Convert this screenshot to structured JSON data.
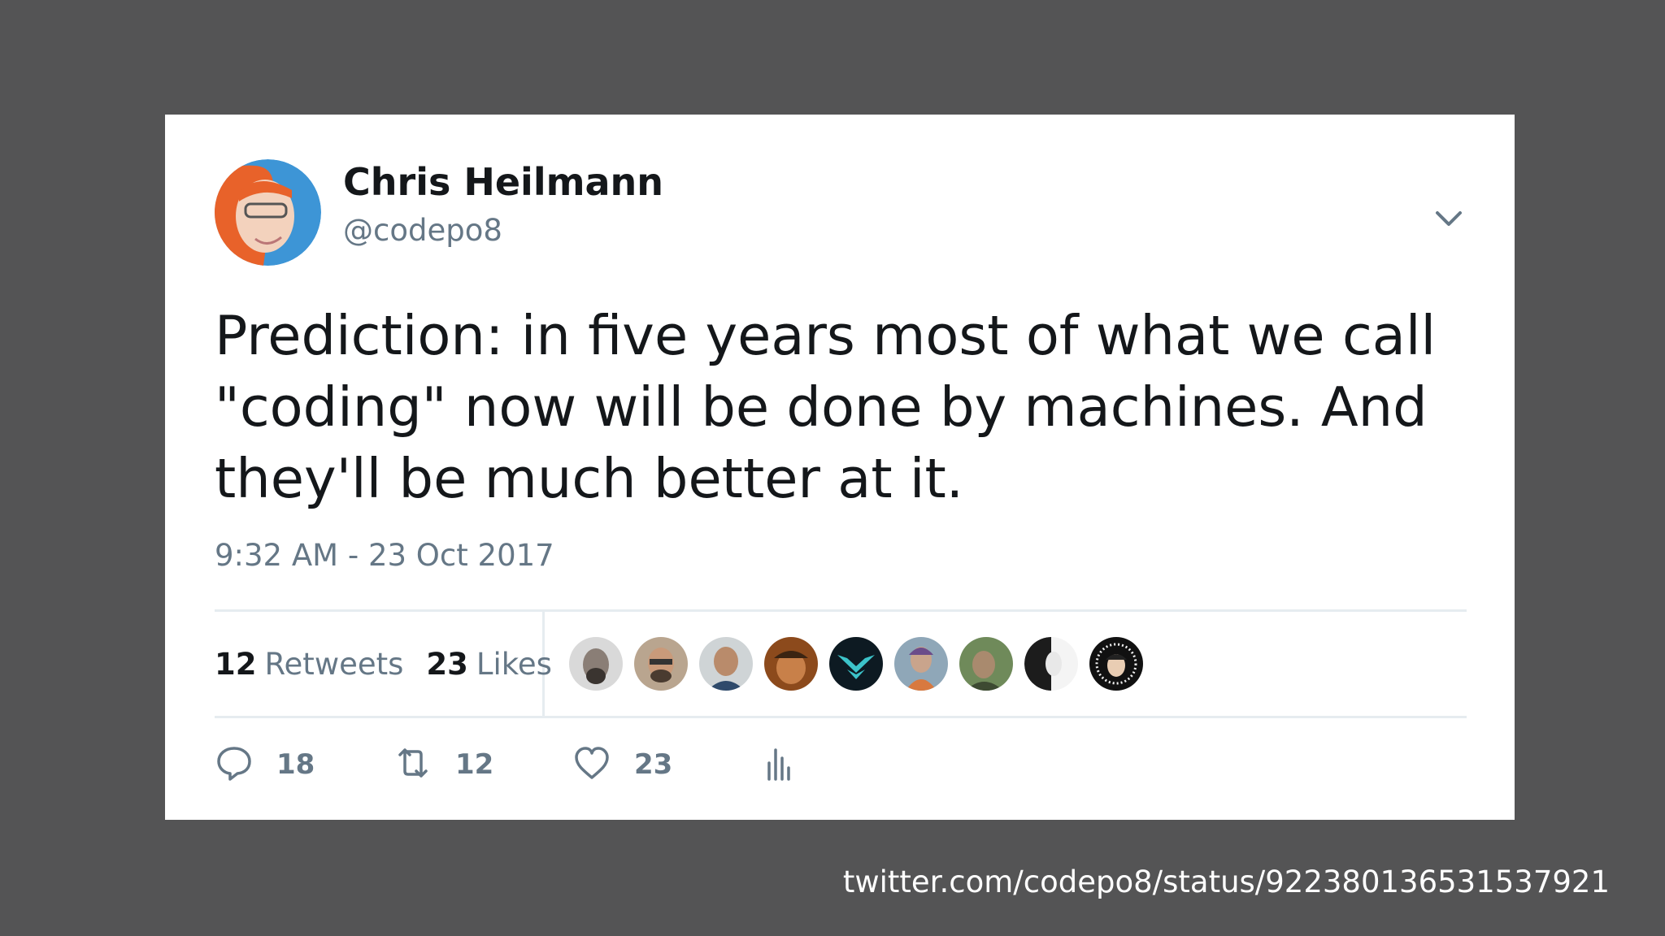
{
  "tweet": {
    "author_name": "Chris Heilmann",
    "author_handle": "@codepo8",
    "text": "Prediction: in five years most of what we call \"coding\" now will be done by machines. And they'll be much better at it.",
    "timestamp": "9:32 AM - 23 Oct 2017",
    "retweets_count": "12",
    "retweets_label": "Retweets",
    "likes_count": "23",
    "likes_label": "Likes",
    "actions": {
      "reply_count": "18",
      "retweet_count": "12",
      "like_count": "23"
    }
  },
  "icons": {
    "menu": "chevron-down-icon",
    "reply": "reply-icon",
    "retweet": "retweet-icon",
    "like": "heart-icon",
    "analytics": "analytics-icon"
  },
  "colors": {
    "background": "#545455",
    "card": "#ffffff",
    "text": "#14171a",
    "muted": "#657786",
    "divider": "#e6ecf0"
  },
  "caption": {
    "url": "twitter.com/codepo8/status/922380136531537921"
  }
}
